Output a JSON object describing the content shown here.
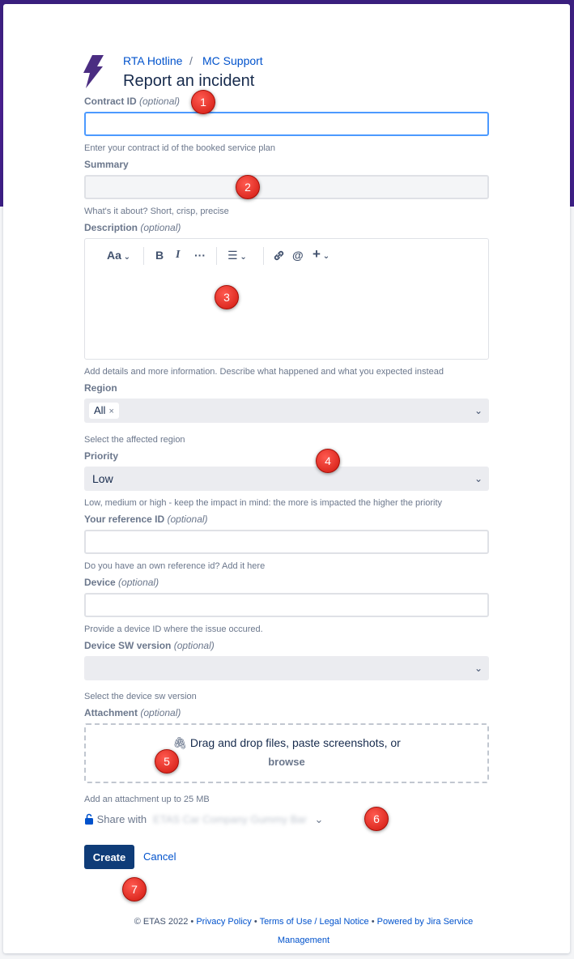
{
  "breadcrumb": {
    "portal": "RTA Hotline",
    "separator": "/",
    "service": "MC Support"
  },
  "page_title": "Report an incident",
  "fields": {
    "contract_id": {
      "label": "Contract ID",
      "optional": "(optional)",
      "help": "Enter your contract id of the booked service plan",
      "value": ""
    },
    "summary": {
      "label": "Summary",
      "help": "What's it about? Short, crisp, precise",
      "value": ""
    },
    "description": {
      "label": "Description",
      "optional": "(optional)",
      "help": "Add details and more information. Describe what happened and what you expected instead",
      "toolbar": {
        "text_style": "Aa",
        "bold": "B",
        "italic": "I",
        "more": "···",
        "list": "☰",
        "link": "🔗",
        "mention": "@",
        "insert": "+"
      }
    },
    "region": {
      "label": "Region",
      "help": "Select the affected region",
      "selected_tag": "All",
      "remove": "×"
    },
    "priority": {
      "label": "Priority",
      "help": "Low, medium or high - keep the impact in mind: the more is impacted the higher the priority",
      "value": "Low"
    },
    "reference_id": {
      "label": "Your reference ID",
      "optional": "(optional)",
      "help": "Do you have an own reference id? Add it here"
    },
    "device": {
      "label": "Device",
      "optional": "(optional)",
      "help": "Provide a device ID where the issue occured."
    },
    "device_sw": {
      "label": "Device SW version",
      "optional": "(optional)",
      "help": "Select the device sw version",
      "value": ""
    },
    "attachment": {
      "label": "Attachment",
      "optional": "(optional)",
      "drop_text": "Drag and drop files, paste screenshots, or",
      "browse": "browse",
      "help": "Add an attachment up to 25 MB"
    }
  },
  "share": {
    "label": "Share with",
    "target": "ETAS Car Company Gummy Bar"
  },
  "actions": {
    "create": "Create",
    "cancel": "Cancel"
  },
  "footer": {
    "copyright": "© ETAS 2022",
    "sep": "•",
    "privacy": "Privacy Policy",
    "terms": "Terms of Use / Legal Notice",
    "powered": "Powered by Jira Service Management"
  },
  "markers": [
    "1",
    "2",
    "3",
    "4",
    "5",
    "6",
    "7"
  ],
  "colors": {
    "primary": "#0052cc",
    "create_button": "#0f3c78",
    "header_bg": "#3a1f7e",
    "marker": "#e02018",
    "logo": "#4b2d82"
  }
}
